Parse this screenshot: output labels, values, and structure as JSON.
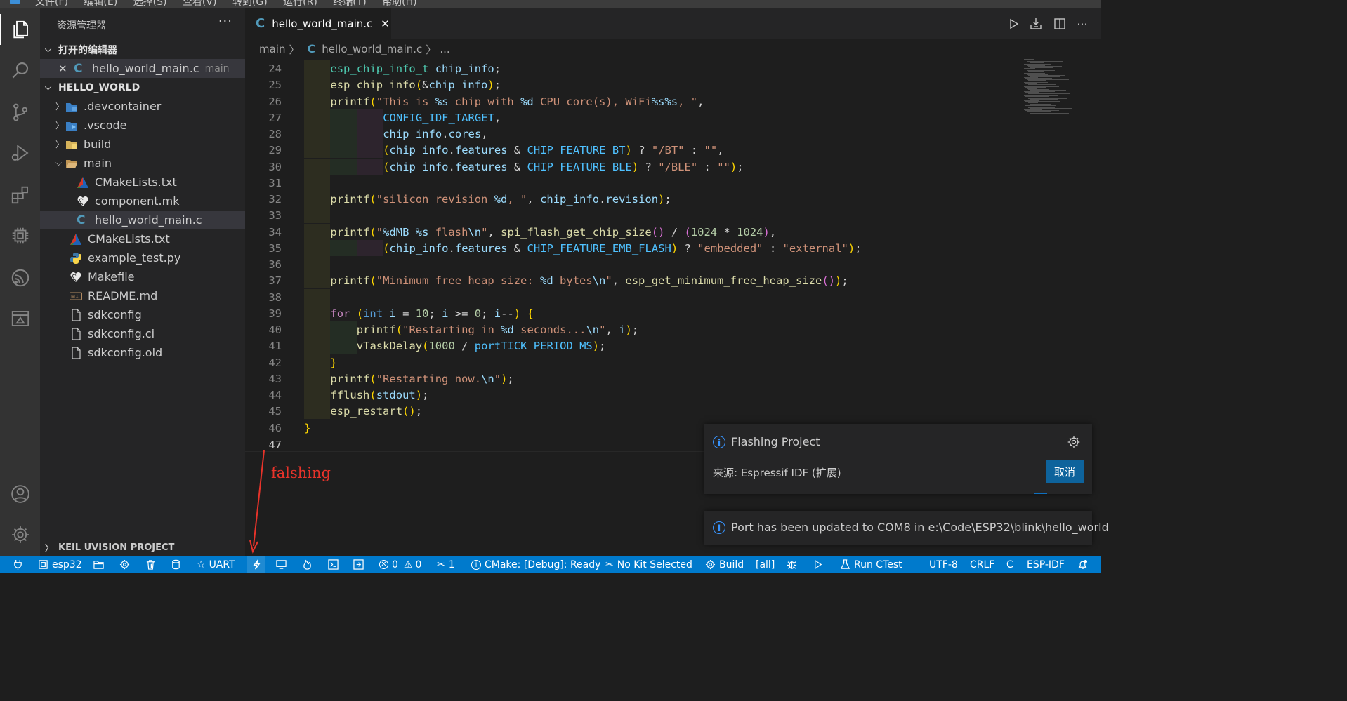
{
  "menu": {
    "items": [
      "文件(F)",
      "编辑(E)",
      "选择(S)",
      "查看(V)",
      "转到(G)",
      "运行(R)",
      "终端(T)",
      "帮助(H)"
    ]
  },
  "activity_bar": {
    "icons": [
      "explorer-icon",
      "search-icon",
      "source-control-icon",
      "run-debug-icon",
      "extensions-icon",
      "chip-icon",
      "espressif-icon",
      "remote-explorer-icon",
      "account-icon",
      "settings-gear-icon"
    ]
  },
  "sidebar": {
    "title": "资源管理器",
    "open_editors_label": "打开的编辑器",
    "open_editor_item": {
      "name": "hello_world_main.c",
      "hint": "main"
    },
    "project_label": "HELLO_WORLD",
    "tree": [
      {
        "name": ".devcontainer",
        "kind": "folder",
        "icon": "devcontainer-icon"
      },
      {
        "name": ".vscode",
        "kind": "folder",
        "icon": "vscode-folder-icon"
      },
      {
        "name": "build",
        "kind": "folder",
        "icon": "build-folder-icon"
      },
      {
        "name": "main",
        "kind": "folder-open",
        "icon": "folder-open-icon"
      },
      {
        "name": "CMakeLists.txt",
        "kind": "file",
        "icon": "cmake-icon"
      },
      {
        "name": "component.mk",
        "kind": "file",
        "icon": "makefile-icon"
      },
      {
        "name": "hello_world_main.c",
        "kind": "file",
        "icon": "c-file-icon"
      },
      {
        "name": "CMakeLists.txt",
        "kind": "file",
        "icon": "cmake-icon"
      },
      {
        "name": "example_test.py",
        "kind": "file",
        "icon": "python-icon"
      },
      {
        "name": "Makefile",
        "kind": "file",
        "icon": "makefile-icon"
      },
      {
        "name": "README.md",
        "kind": "file",
        "icon": "markdown-icon"
      },
      {
        "name": "sdkconfig",
        "kind": "file",
        "icon": "file-icon"
      },
      {
        "name": "sdkconfig.ci",
        "kind": "file",
        "icon": "file-icon"
      },
      {
        "name": "sdkconfig.old",
        "kind": "file",
        "icon": "file-icon"
      }
    ],
    "bottom_section": "KEIL UVISION PROJECT"
  },
  "editor": {
    "tab_label": "hello_world_main.c",
    "breadcrumb": {
      "folder": "main",
      "file": "hello_world_main.c",
      "tail": "..."
    },
    "lines": [
      {
        "n": "24",
        "text": "esp_chip_info_t chip_info;"
      },
      {
        "n": "25",
        "text": "esp_chip_info(&chip_info);"
      },
      {
        "n": "26",
        "text": "printf(\"This is %s chip with %d CPU core(s), WiFi%s%s, \","
      },
      {
        "n": "27",
        "text": "CONFIG_IDF_TARGET,"
      },
      {
        "n": "28",
        "text": "chip_info.cores,"
      },
      {
        "n": "29",
        "text": "(chip_info.features & CHIP_FEATURE_BT) ? \"/BT\" : \"\","
      },
      {
        "n": "30",
        "text": "(chip_info.features & CHIP_FEATURE_BLE) ? \"/BLE\" : \"\");"
      },
      {
        "n": "31",
        "text": ""
      },
      {
        "n": "32",
        "text": "printf(\"silicon revision %d, \", chip_info.revision);"
      },
      {
        "n": "33",
        "text": ""
      },
      {
        "n": "34",
        "text": "printf(\"%dMB %s flash\\n\", spi_flash_get_chip_size() / (1024 * 1024),"
      },
      {
        "n": "35",
        "text": "(chip_info.features & CHIP_FEATURE_EMB_FLASH) ? \"embedded\" : \"external\");"
      },
      {
        "n": "36",
        "text": ""
      },
      {
        "n": "37",
        "text": "printf(\"Minimum free heap size: %d bytes\\n\", esp_get_minimum_free_heap_size());"
      },
      {
        "n": "38",
        "text": ""
      },
      {
        "n": "39",
        "text": "for (int i = 10; i >= 0; i--) {"
      },
      {
        "n": "40",
        "text": "printf(\"Restarting in %d seconds...\\n\", i);"
      },
      {
        "n": "41",
        "text": "vTaskDelay(1000 / portTICK_PERIOD_MS);"
      },
      {
        "n": "42",
        "text": "}"
      },
      {
        "n": "43",
        "text": "printf(\"Restarting now.\\n\");"
      },
      {
        "n": "44",
        "text": "fflush(stdout);"
      },
      {
        "n": "45",
        "text": "esp_restart();"
      },
      {
        "n": "46",
        "text": "}"
      },
      {
        "n": "47",
        "text": ""
      }
    ]
  },
  "annotation": "falshing",
  "notifications": {
    "flashing": {
      "title": "Flashing Project",
      "source": "来源: Espressif IDF (扩展)",
      "cancel_label": "取消"
    },
    "port": {
      "message": "Port has been updated to COM8 in e:\\Code\\ESP32\\blink\\hello_world"
    }
  },
  "statusbar": {
    "target": "esp32",
    "uart": "UART",
    "errors": "0",
    "warnings": "0",
    "tools_count": "1",
    "cmake": "CMake: [Debug]: Ready",
    "kit": "No Kit Selected",
    "build": "Build",
    "build_target": "[all]",
    "ctest": "Run CTest",
    "encoding": "UTF-8",
    "eol": "CRLF",
    "language": "C",
    "idf": "ESP-IDF"
  },
  "colors": {
    "accent_blue": "#007acc",
    "button_blue": "#0e639c",
    "annotation_red": "#e8332a",
    "c_file_blue": "#519aba"
  }
}
